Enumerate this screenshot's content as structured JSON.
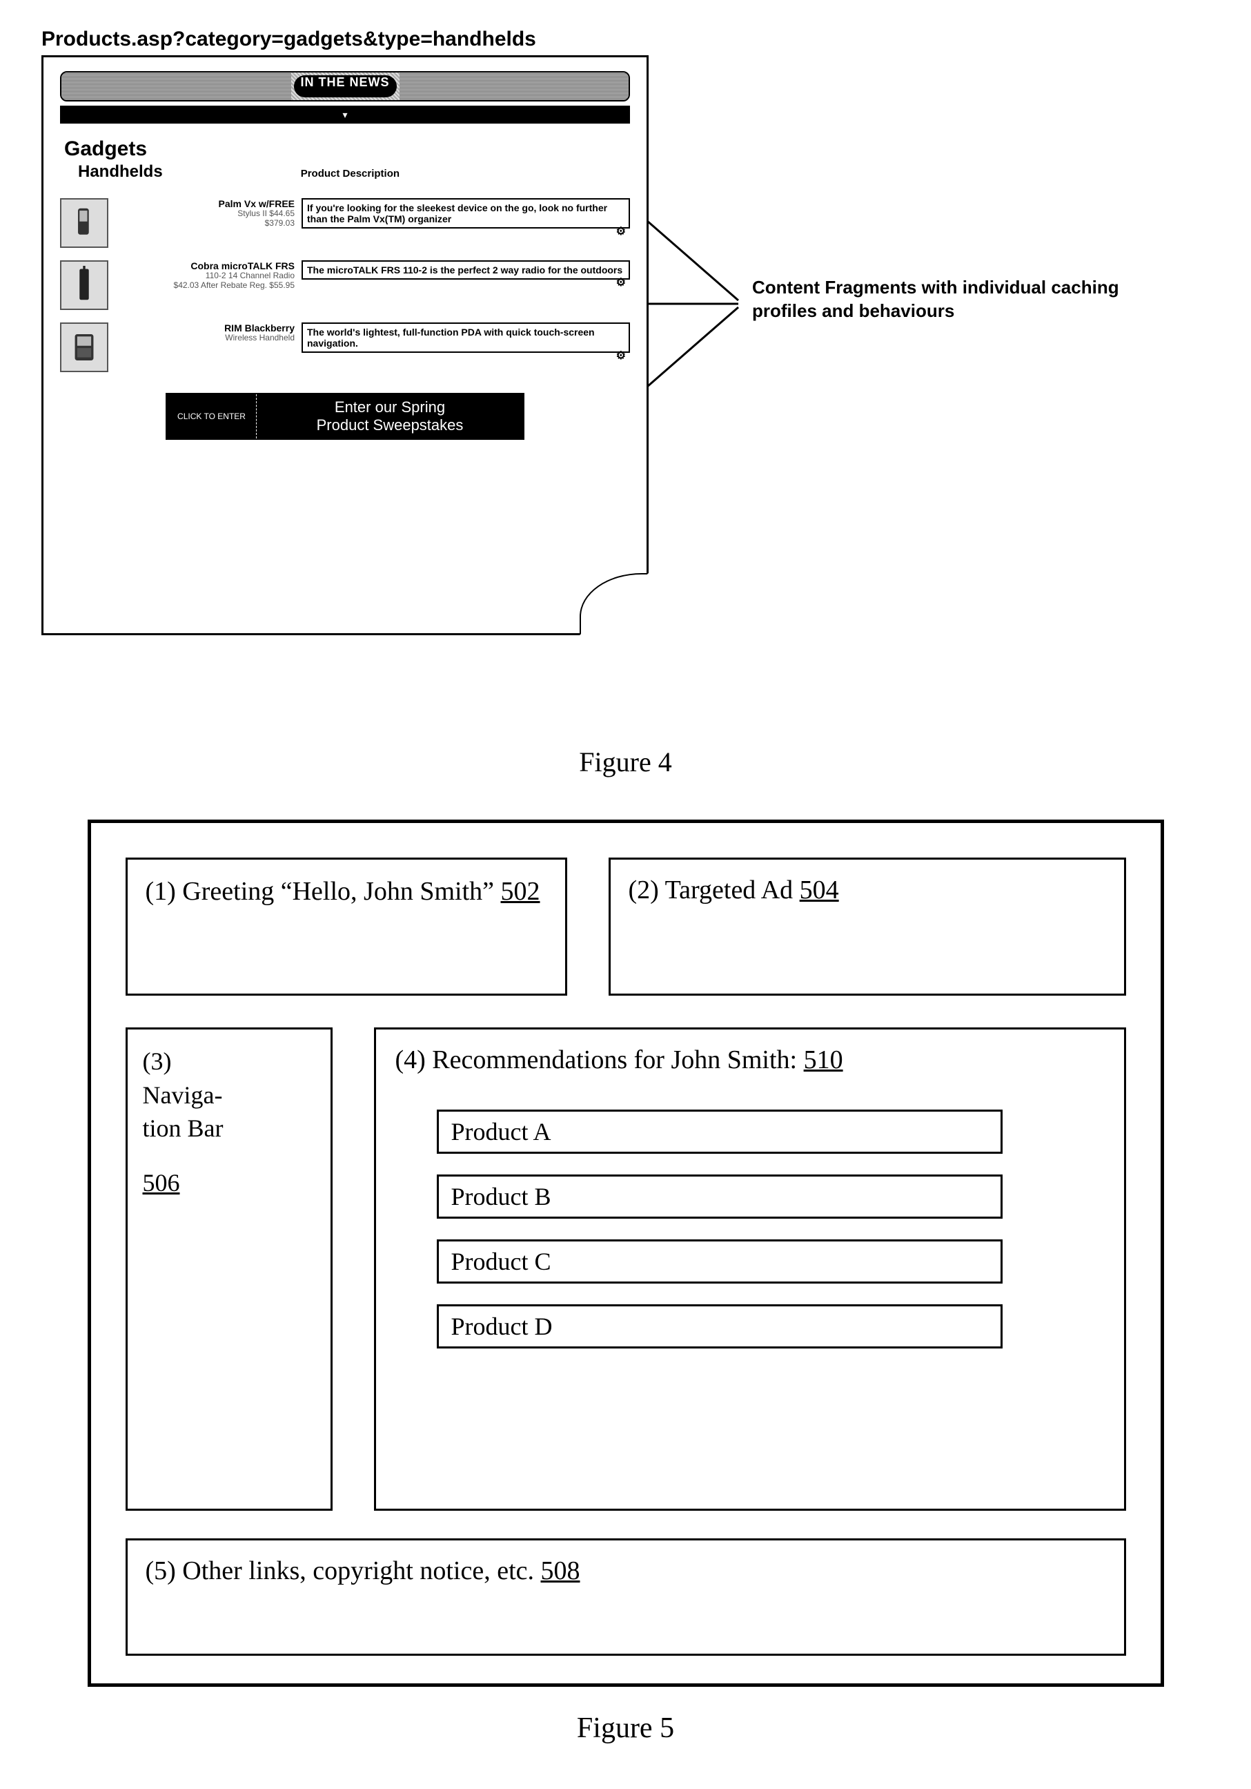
{
  "fig4": {
    "url": "Products.asp?category=gadgets&type=handhelds",
    "nav_center": "IN THE NEWS",
    "category": "Gadgets",
    "subcategory": "Handhelds",
    "product_desc_header": "Product Description",
    "products": [
      {
        "title": "Palm Vx w/FREE",
        "line2": "Stylus II $44.65",
        "line3": "$379.03",
        "desc": "If you're looking for the sleekest device on the go, look no further than the Palm Vx(TM) organizer"
      },
      {
        "title": "Cobra microTALK FRS",
        "line2": "110-2 14 Channel Radio",
        "line3": "$42.03 After Rebate  Reg. $55.95",
        "desc": "The microTALK FRS 110-2 is the perfect 2 way radio for the outdoors"
      },
      {
        "title": "RIM Blackberry",
        "line2": "Wireless Handheld",
        "line3": "",
        "desc": "The world's lightest, full-function PDA with quick touch-screen navigation."
      }
    ],
    "banner_pill": "CLICK TO ENTER",
    "banner_text1": "Enter our Spring",
    "banner_text2": "Product Sweepstakes",
    "callout": "Content Fragments with individual caching profiles and behaviours",
    "caption": "Figure 4"
  },
  "fig5": {
    "greeting_prefix": "(1) Greeting “Hello, John Smith” ",
    "greeting_ref": "502",
    "ad_prefix": "(2) Targeted Ad  ",
    "ad_ref": "504",
    "nav_line1": "(3)",
    "nav_line2": "Naviga-",
    "nav_line3": "tion Bar",
    "nav_ref": "506",
    "reco_prefix": "(4) Recommendations for John Smith:  ",
    "reco_ref": "510",
    "products": [
      "Product A",
      "Product B",
      "Product C",
      "Product D"
    ],
    "footer_prefix": "(5) Other links, copyright notice, etc. ",
    "footer_ref": "508",
    "caption": "Figure 5"
  }
}
